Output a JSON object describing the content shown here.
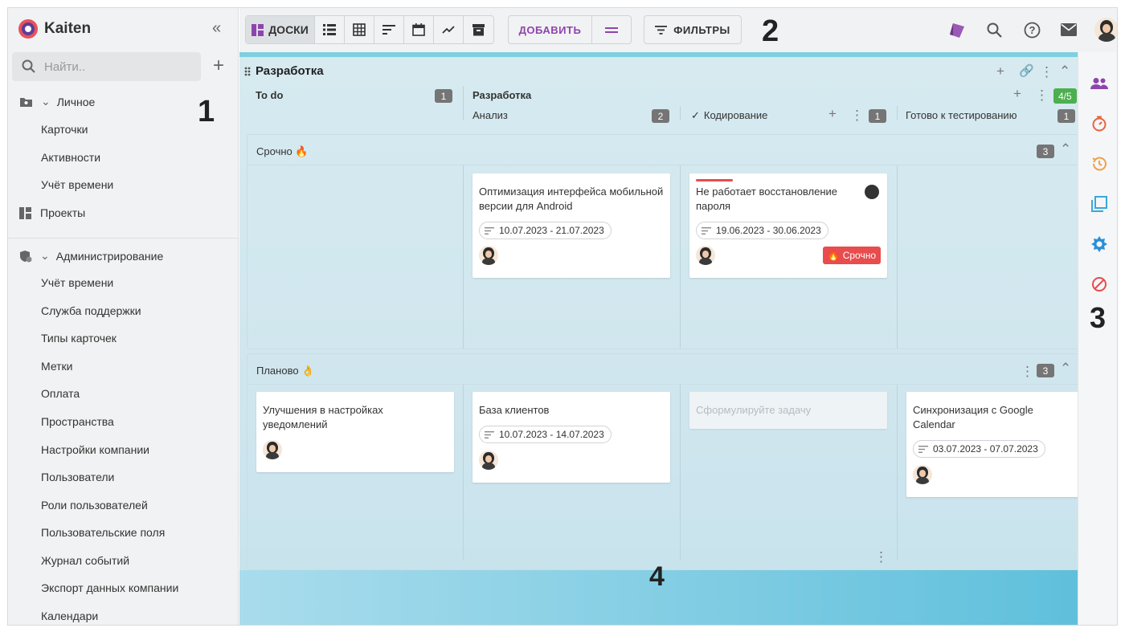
{
  "app": {
    "name": "Kaiten",
    "collapse_icon": "double-chevron-left-icon"
  },
  "search": {
    "placeholder": "Найти.."
  },
  "sidebar": {
    "personal": {
      "label": "Личное",
      "items": [
        "Карточки",
        "Активности",
        "Учёт времени"
      ]
    },
    "projects": {
      "label": "Проекты"
    },
    "admin": {
      "label": "Администрирование",
      "items": [
        "Учёт времени",
        "Служба поддержки",
        "Типы карточек",
        "Метки",
        "Оплата",
        "Пространства",
        "Настройки компании",
        "Пользователи",
        "Роли пользователей",
        "Пользовательские поля",
        "Журнал событий",
        "Экспорт данных компании",
        "Календари"
      ]
    }
  },
  "toolbar": {
    "boards_label": "ДОСКИ",
    "add_label": "ДОБАВИТЬ",
    "filters_label": "ФИЛЬТРЫ",
    "icons": [
      "list-view-icon",
      "table-view-icon",
      "timeline-icon",
      "calendar-icon",
      "chart-icon",
      "archive-icon"
    ],
    "right_icons": [
      "sprint-icon",
      "search-icon",
      "help-icon",
      "mail-icon",
      "user-avatar"
    ]
  },
  "markers": {
    "one": "1",
    "two": "2",
    "three": "3",
    "four": "4"
  },
  "board": {
    "title": "Разработка",
    "columns": {
      "todo": {
        "label": "To do",
        "count": "1"
      },
      "dev": {
        "label": "Разработка",
        "wip": "4/5"
      },
      "analysis": {
        "label": "Анализ",
        "count": "2"
      },
      "coding": {
        "label": "Кодирование",
        "count": "1"
      },
      "testing": {
        "label": "Готово к тестированию",
        "count": "1"
      }
    },
    "lanes": {
      "urgent": {
        "label": "Срочно 🔥",
        "count": "3"
      },
      "planned": {
        "label": "Планово 👌",
        "count": "3"
      }
    },
    "cards": {
      "c1": {
        "title": "Оптимизация интерфейса мобильной версии для Android",
        "dates": "10.07.2023 - 21.07.2023"
      },
      "c2": {
        "title": "Не работает восстановление пароля",
        "dates": "19.06.2023 - 30.06.2023",
        "tag": "Срочно"
      },
      "c3": {
        "title": "Улучшения в настройках уведомлений"
      },
      "c4": {
        "title": "База клиентов",
        "dates": "10.07.2023 - 14.07.2023"
      },
      "c5": {
        "placeholder": "Сформулируйте задачу"
      },
      "c6": {
        "title": "Синхронизация с Google Calendar",
        "dates": "03.07.2023 - 07.07.2023"
      }
    }
  },
  "rightbar": {
    "icons": [
      "team-icon",
      "timer-icon",
      "history-icon",
      "copy-icon",
      "settings-gear-icon",
      "blocked-icon"
    ]
  },
  "colors": {
    "accent": "#8e44ad",
    "urgent": "#e84c4c",
    "wip": "#4caf50",
    "rightbar_team": "#8e44ad",
    "rightbar_timer": "#e8643c",
    "rightbar_history": "#f0a04b",
    "rightbar_copy": "#3aa8d8",
    "rightbar_gear": "#2a8fd8",
    "rightbar_blocked": "#e84c4c"
  }
}
